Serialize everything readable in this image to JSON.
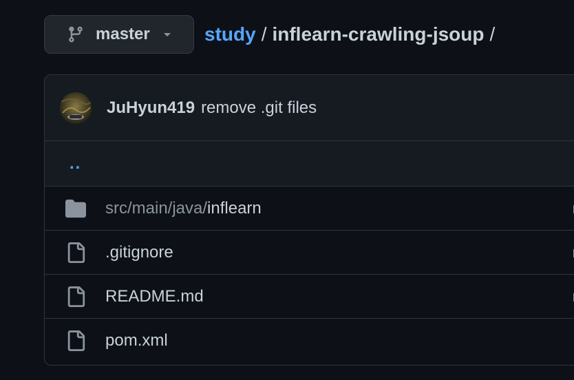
{
  "branch": {
    "name": "master",
    "icon": "git-branch-icon"
  },
  "breadcrumb": {
    "parent": "study",
    "separator": "/",
    "current": "inflearn-crawling-jsoup",
    "trailing": "/"
  },
  "commit": {
    "author": "JuHyun419",
    "message": "remove .git files"
  },
  "files": {
    "parent_link": "..",
    "rows": [
      {
        "type": "folder",
        "prefix": "src/main/java/",
        "name": "inflearn",
        "icon": "folder-icon"
      },
      {
        "type": "file",
        "prefix": "",
        "name": ".gitignore",
        "icon": "file-icon"
      },
      {
        "type": "file",
        "prefix": "",
        "name": "README.md",
        "icon": "file-icon"
      },
      {
        "type": "file",
        "prefix": "",
        "name": "pom.xml",
        "icon": "file-icon"
      }
    ]
  },
  "colors": {
    "background": "#0d1117",
    "link": "#58a6ff",
    "text": "#c9d1d9",
    "muted": "#8b949e",
    "border": "#30363d"
  }
}
